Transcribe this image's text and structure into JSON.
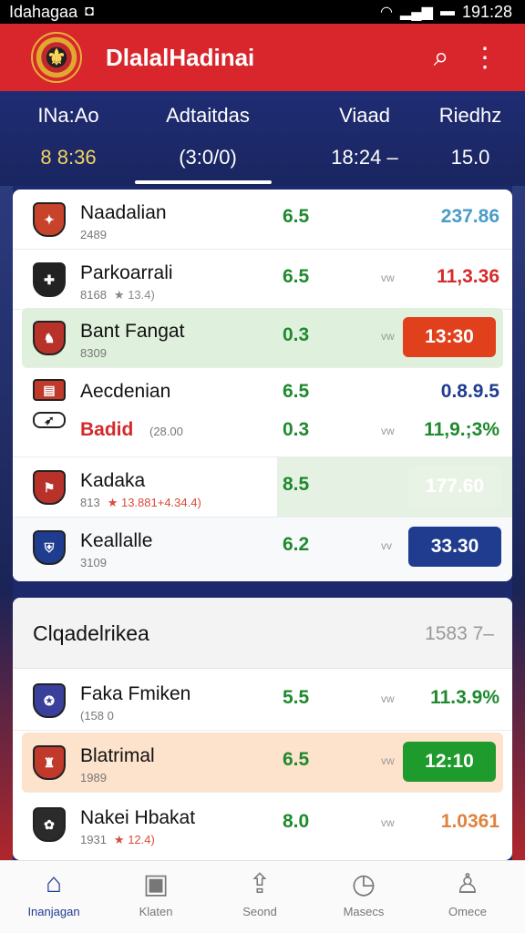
{
  "status_bar": {
    "app_name": "Idahagaa",
    "app_glyph": "◘",
    "time": "191:28",
    "wifi": "◠",
    "signal": "▂▄▆",
    "battery": "▬"
  },
  "app_bar": {
    "title": "DlalalHadinai",
    "logo_glyph": "⚜",
    "search_icon": "⌕",
    "menu_icon": "⋮"
  },
  "tabs": [
    {
      "label": "INa:Ao",
      "value": "8 8:36"
    },
    {
      "label": "Adtaitdas",
      "value": "(3:0/0)"
    },
    {
      "label": "Viaad",
      "value": "18:24 –"
    },
    {
      "label": "Riedhz",
      "value": "15.0"
    }
  ],
  "card1": {
    "rows": [
      {
        "name": "Naadalian",
        "sub": "2489",
        "odds": "6.5",
        "vw": "",
        "price": "237.86",
        "price_color": "#4a9cc8",
        "badge_color": "#c8432b"
      },
      {
        "name": "Parkoarrali",
        "sub": "8168",
        "rating": "★ 13.4)",
        "odds": "6.5",
        "vw": "vw",
        "price": "11,3.36",
        "price_color": "#d42a2a",
        "badge_color": "#222222"
      },
      {
        "name": "Bant Fangat",
        "sub": "8309",
        "odds": "0.3",
        "vw": "vw",
        "price": "13:30",
        "pill_color": "#e0411c",
        "badge_color": "#b8322a"
      },
      {
        "name": "Aecdenian",
        "name2": "Badid",
        "sub2": "(28.00",
        "odds": "6.5",
        "odds2": "0.3",
        "vw": "vw",
        "price": "0.8.9.5",
        "price_color": "#1f3c8f",
        "price2": "11,9.;3%",
        "price2_color": "#1e8a2e",
        "badge_color": "#c0392b"
      },
      {
        "name": "Kadaka",
        "sub": "813",
        "rating": "★ 13.881+4.34.4)",
        "odds": "8.5",
        "vw": "",
        "price": "177.60",
        "pill_color": "#e8f3e6",
        "badge_color": "#b8322a"
      },
      {
        "name": "Keallalle",
        "sub": "3109",
        "odds": "6.2",
        "vw": "vv",
        "price": "33.30",
        "pill_color": "#1f3c8f",
        "badge_color": "#1f3c8f"
      }
    ]
  },
  "card2": {
    "header_title": "Clqadelrikea",
    "header_value": "1583 7–",
    "rows": [
      {
        "name": "Faka Fmiken",
        "sub": "(158 0",
        "odds": "5.5",
        "vw": "vw",
        "price": "11.3.9%",
        "price_color": "#1e8a2e",
        "badge_color": "#3a3f9c"
      },
      {
        "name": "Blatrimal",
        "sub": "1989",
        "odds": "6.5",
        "vw": "vw",
        "price": "12:10",
        "pill_color": "#1f9a2c",
        "badge_color": "#c0392b"
      },
      {
        "name": "Nakei Hbakat",
        "sub": "1931",
        "rating": "★ 12.4)",
        "odds": "8.0",
        "vw": "vw",
        "price": "1.0361",
        "price_color": "#e0823e",
        "badge_color": "#2b2b2b"
      }
    ]
  },
  "bottom_nav": [
    {
      "label": "Inanjagan",
      "icon": "⌂"
    },
    {
      "label": "Klaten",
      "icon": "▣"
    },
    {
      "label": "Seond",
      "icon": "⇪"
    },
    {
      "label": "Masecs",
      "icon": "◷"
    },
    {
      "label": "Omece",
      "icon": "♙"
    }
  ],
  "colors": {
    "app_bar": "#d8262c",
    "header": "#1f2c73",
    "accent_green": "#1e8a2e"
  }
}
